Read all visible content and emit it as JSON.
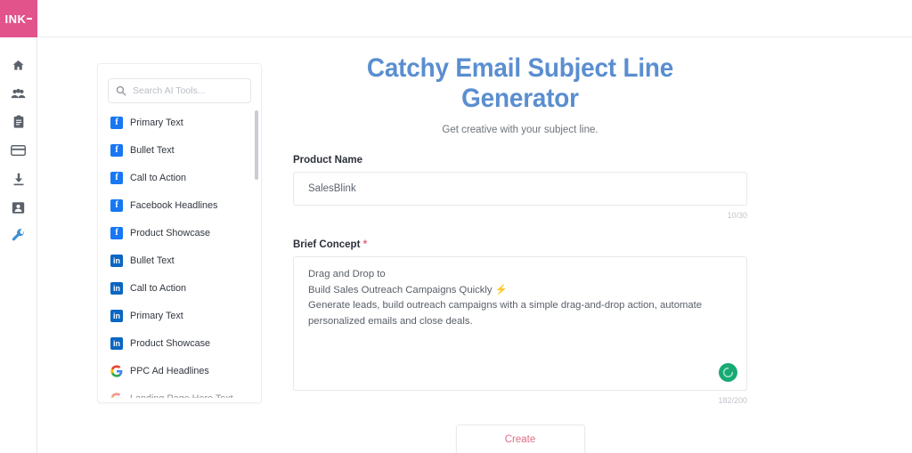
{
  "brand": {
    "logo_text": "INK",
    "logo_bg": "#e2538c"
  },
  "rail": {
    "items": [
      {
        "name": "home-icon",
        "label": "Home"
      },
      {
        "name": "users-icon",
        "label": "Team"
      },
      {
        "name": "clipboard-icon",
        "label": "Projects"
      },
      {
        "name": "card-icon",
        "label": "Billing"
      },
      {
        "name": "download-icon",
        "label": "Downloads"
      },
      {
        "name": "id-card-icon",
        "label": "Account"
      },
      {
        "name": "wrench-icon",
        "label": "AI Tools"
      }
    ],
    "active_index": 6,
    "active_color": "#3e8fd4",
    "icon_color": "#5b616b"
  },
  "tools_panel": {
    "search": {
      "placeholder": "Search AI Tools...",
      "value": ""
    },
    "items": [
      {
        "platform": "facebook",
        "glyph": "f",
        "label": "Primary Text"
      },
      {
        "platform": "facebook",
        "glyph": "f",
        "label": "Bullet Text"
      },
      {
        "platform": "facebook",
        "glyph": "f",
        "label": "Call to Action"
      },
      {
        "platform": "facebook",
        "glyph": "f",
        "label": "Facebook Headlines"
      },
      {
        "platform": "facebook",
        "glyph": "f",
        "label": "Product Showcase"
      },
      {
        "platform": "linkedin",
        "glyph": "in",
        "label": "Bullet Text"
      },
      {
        "platform": "linkedin",
        "glyph": "in",
        "label": "Call to Action"
      },
      {
        "platform": "linkedin",
        "glyph": "in",
        "label": "Primary Text"
      },
      {
        "platform": "linkedin",
        "glyph": "in",
        "label": "Product Showcase"
      },
      {
        "platform": "google",
        "glyph": "G",
        "label": "PPC Ad Headlines"
      },
      {
        "platform": "google",
        "glyph": "G",
        "label": "Landing Page Hero Text"
      }
    ],
    "colors": {
      "facebook": "#1877f2",
      "linkedin": "#0a66c2"
    }
  },
  "main": {
    "title": "Catchy Email Subject Line Generator",
    "title_color": "#5a8ed0",
    "subtitle": "Get creative with your subject line.",
    "product_name": {
      "label": "Product Name",
      "value": "SalesBlink",
      "placeholder": "Product Name",
      "counter": "10/30"
    },
    "brief_concept": {
      "label": "Brief Concept",
      "required_mark": "*",
      "value": "Drag and Drop to\nBuild Sales Outreach Campaigns Quickly ⚡\nGenerate leads, build outreach campaigns with a simple drag-and-drop action, automate personalized emails and close deals.",
      "placeholder": "Brief Concept",
      "counter": "182/200",
      "status_icon": "loading-spinner-icon",
      "status_color": "#19a974"
    },
    "create_button": {
      "label": "Create",
      "text_color": "#dc6e85"
    }
  }
}
